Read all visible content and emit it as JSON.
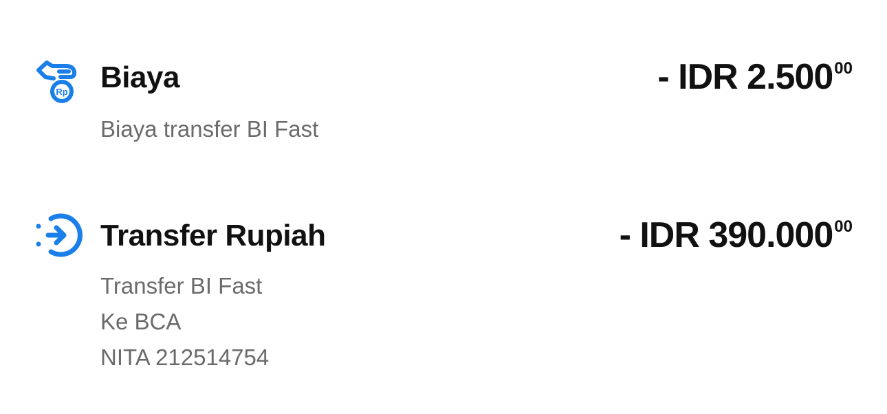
{
  "colors": {
    "accent": "#1a7fe8",
    "title": "#111111",
    "subtext": "#6b6b6b"
  },
  "transactions": [
    {
      "icon": "hand-coin-rp-icon",
      "icon_label": "Rp",
      "title": "Biaya",
      "amount_main": "- IDR 2.500",
      "amount_cents": "00",
      "details": [
        "Biaya transfer BI Fast"
      ]
    },
    {
      "icon": "transfer-arrow-circle-icon",
      "title": "Transfer Rupiah",
      "amount_main": "- IDR 390.000",
      "amount_cents": "00",
      "details": [
        "Transfer BI Fast",
        "Ke BCA",
        "NITA 212514754"
      ]
    }
  ]
}
